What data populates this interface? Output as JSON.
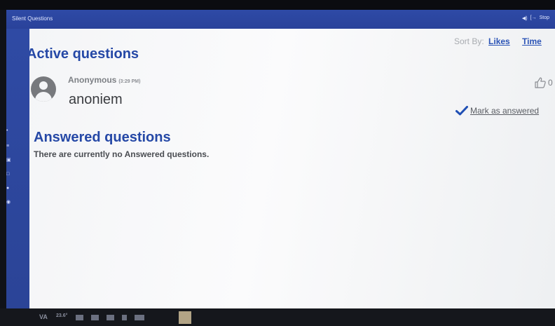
{
  "app": {
    "title": "Silent Questions",
    "titlebar_icons": [
      "speaker-icon",
      "exit-icon"
    ],
    "titlebar_right_text": "Stop"
  },
  "sections": {
    "active": {
      "heading": "Active questions"
    },
    "answered": {
      "heading": "Answered questions",
      "empty_text": "There are currently no Answered questions."
    }
  },
  "sort": {
    "label": "Sort By:",
    "options": [
      "Likes",
      "Time"
    ]
  },
  "questions": [
    {
      "author": "Anonymous",
      "time": "(3:29 PM)",
      "text": "anoniem",
      "likes": "0",
      "mark_answered_label": "Mark as answered"
    }
  ],
  "taskbar": {
    "label": "VA",
    "temperature": "23.6°"
  },
  "colors": {
    "titlebar": "#2e4aa6",
    "heading": "#2548a6",
    "link": "#2b54b6",
    "check": "#1f4fb4",
    "background": "#f4f5f7"
  }
}
